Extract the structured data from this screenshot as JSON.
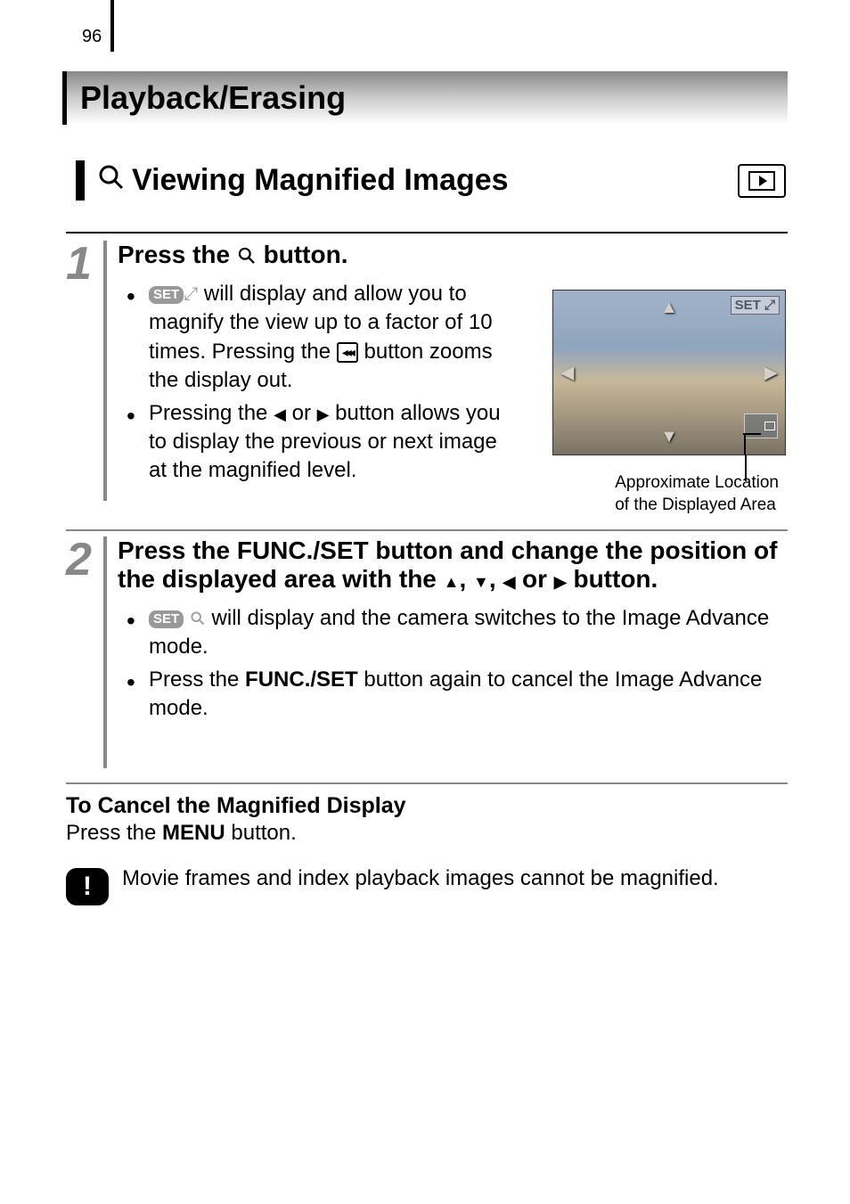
{
  "page_number": "96",
  "chapter_title": "Playback/Erasing",
  "section_title": "Viewing Magnified Images",
  "step1": {
    "title_prefix": "Press the ",
    "title_suffix": " button.",
    "bullet1_prefix": " will display and allow you to magnify the view up to a factor of 10 times. Pressing the ",
    "bullet1_suffix": " button zooms the display out.",
    "bullet2_prefix": "Pressing the ",
    "bullet2_mid": " or ",
    "bullet2_suffix": " button allows you to display the previous or next image at the magnified level.",
    "set_label": "SET",
    "image_overlay": "SET ⤢",
    "caption_line1": "Approximate Location",
    "caption_line2": "of the Displayed Area"
  },
  "step2": {
    "title_prefix": "Press the FUNC./SET button and change the position of the displayed area with the ",
    "title_mid1": ", ",
    "title_mid2": ", ",
    "title_mid3": " or ",
    "title_suffix": " button.",
    "bullet1": " will display and the camera switches to the Image Advance mode.",
    "bullet2_prefix": "Press the ",
    "bullet2_bold": "FUNC./SET",
    "bullet2_suffix": " button again to cancel the Image Advance mode.",
    "set_label": "SET"
  },
  "cancel": {
    "title": "To Cancel the Magnified Display",
    "text_prefix": "Press the ",
    "text_bold": "MENU",
    "text_suffix": " button."
  },
  "note": {
    "text": "Movie frames and index playback images cannot be magnified."
  }
}
